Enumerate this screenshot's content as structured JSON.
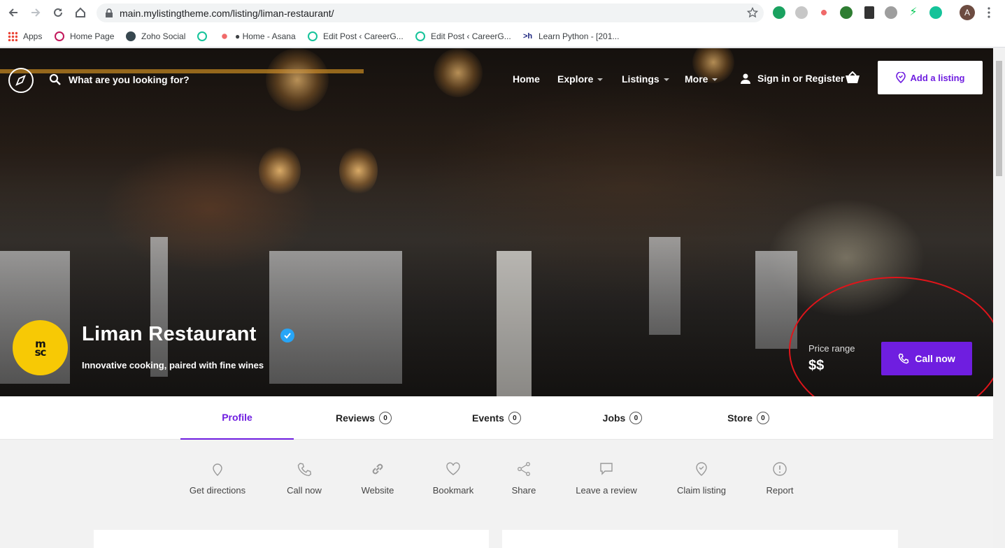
{
  "browser": {
    "url": "main.mylistingtheme.com/listing/liman-restaurant/",
    "avatar_letter": "A",
    "bookmarks": [
      "Apps",
      "Home Page",
      "Zoho Social",
      "",
      "● Home - Asana",
      "Edit Post ‹ CareerG...",
      "Edit Post ‹ CareerG...",
      "Learn Python - [201..."
    ]
  },
  "header": {
    "search_placeholder": "What are you looking for?",
    "menu": [
      "Home",
      "Explore",
      "Listings",
      "More"
    ],
    "signin": "Sign in or Register",
    "add_listing": "Add a listing"
  },
  "listing": {
    "logo_text_top": "m",
    "logo_text_bottom": "sc",
    "title": "Liman Restaurant",
    "tagline": "Innovative cooking, paired with fine wines",
    "price_label": "Price range",
    "price_value": "$$",
    "call_button": "Call now"
  },
  "tabs": [
    {
      "label": "Profile",
      "count": null
    },
    {
      "label": "Reviews",
      "count": "0"
    },
    {
      "label": "Events",
      "count": "0"
    },
    {
      "label": "Jobs",
      "count": "0"
    },
    {
      "label": "Store",
      "count": "0"
    }
  ],
  "actions": [
    "Get directions",
    "Call now",
    "Website",
    "Bookmark",
    "Share",
    "Leave a review",
    "Claim listing",
    "Report"
  ],
  "colors": {
    "accent": "#6f1ee0",
    "logo_bg": "#f7c905",
    "verified": "#27a5f7",
    "annotation": "#e0141a"
  }
}
